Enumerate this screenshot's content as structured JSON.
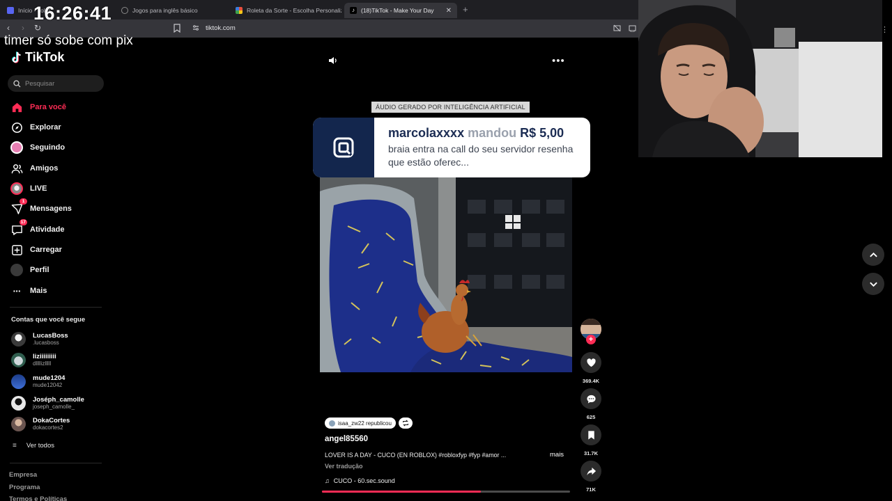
{
  "stream": {
    "timer": "16:26:41",
    "subline": "timer só sobe com pix"
  },
  "browser": {
    "tabs": [
      {
        "label": "Início - Jobb",
        "favicon_color": "#5865f2"
      },
      {
        "label": "Jogos para inglês básico",
        "favicon_color": "#8a8a8a"
      },
      {
        "label": "Roleta da Sorte - Escolha Personaliza",
        "favicon_color": "#e94f3c"
      },
      {
        "label": "(18)TikTok - Make Your Day",
        "favicon_color": "#000000"
      }
    ],
    "url": "tiktok.com"
  },
  "sidebar": {
    "brand": "TikTok",
    "search_placeholder": "Pesquisar",
    "nav": [
      {
        "label": "Para você",
        "icon": "home-icon",
        "badge": ""
      },
      {
        "label": "Explorar",
        "icon": "compass-icon",
        "badge": ""
      },
      {
        "label": "Seguindo",
        "icon": "following-avatar-icon",
        "badge": ""
      },
      {
        "label": "Amigos",
        "icon": "friends-icon",
        "badge": ""
      },
      {
        "label": "LIVE",
        "icon": "live-icon",
        "badge": ""
      },
      {
        "label": "Mensagens",
        "icon": "messages-icon",
        "badge": "1"
      },
      {
        "label": "Atividade",
        "icon": "activity-icon",
        "badge": "17"
      },
      {
        "label": "Carregar",
        "icon": "upload-icon",
        "badge": ""
      },
      {
        "label": "Perfil",
        "icon": "profile-icon",
        "badge": ""
      },
      {
        "label": "Mais",
        "icon": "more-icon",
        "badge": ""
      }
    ],
    "following_title": "Contas que você segue",
    "following": [
      {
        "name": "LucasBoss",
        "handle": ".lucasboss"
      },
      {
        "name": "liziiiiiiiii",
        "handle": "dllllizlllll"
      },
      {
        "name": "mude1204",
        "handle": "mude12042"
      },
      {
        "name": "Joséph_camolle",
        "handle": "joseph_camolle_"
      },
      {
        "name": "DokaCortes",
        "handle": "dokacortes2"
      }
    ],
    "see_all": "Ver todos",
    "footer": [
      "Empresa",
      "Programa",
      "Termos e Políticas"
    ]
  },
  "video": {
    "ai_label": "ÁUDIO GERADO POR INTELIGÊNCIA ARTIFICIAL",
    "donation": {
      "donor": "marcolaxxxx",
      "verb": "mandou",
      "amount": "R$ 5,00",
      "message": "braia entra na call do seu servidor resenha que estão oferec..."
    },
    "reposted_by": "isaa_zw22 republicou",
    "author": "angel85560",
    "caption": "LOVER IS A DAY - CUCO (EN ROBLOX) #robloxfyp #fyp #amor ...",
    "more_label": "mais",
    "translate_label": "Ver tradução",
    "sound": "CUCO - 60.sec.sound",
    "progress": 0.64,
    "stats": {
      "likes": "369.4K",
      "comments": "625",
      "saves": "31.7K",
      "shares": "71K"
    }
  }
}
